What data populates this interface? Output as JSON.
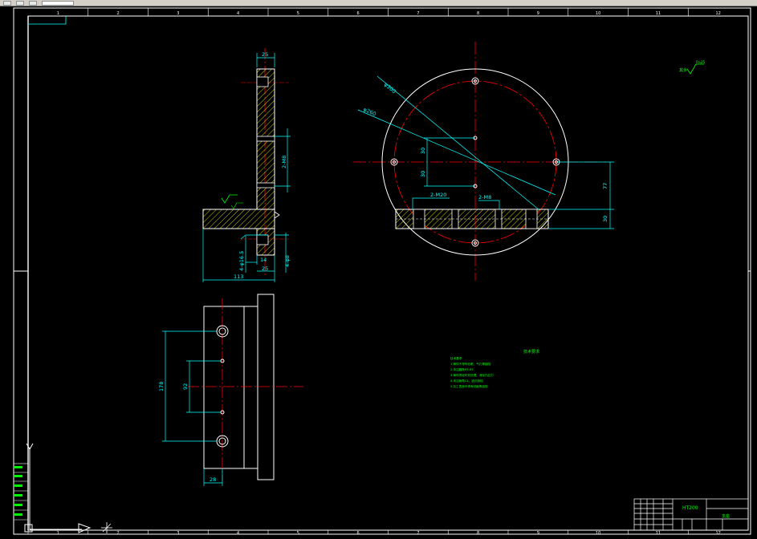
{
  "colors": {
    "background": "#000000",
    "frame": "#ffffff",
    "dimension": "#00ffff",
    "centerline": "#ff0000",
    "annotation": "#00ff00",
    "hatch": "#ffff00"
  },
  "frame": {
    "top_zones": [
      "1",
      "2",
      "3",
      "4",
      "5",
      "6",
      "7",
      "8",
      "9",
      "10",
      "11",
      "12"
    ],
    "bottom_zones": [
      "1",
      "2",
      "3",
      "4",
      "5",
      "6",
      "7",
      "8",
      "9",
      "10",
      "11",
      "12"
    ]
  },
  "section_view": {
    "dims": {
      "top_width": "25",
      "thread_upper": "2-M8",
      "flange_length": "113",
      "hole_dia": "4-φ16.5",
      "inner_14": "14",
      "inner_25": "25",
      "thread_lower": "4-φ8"
    }
  },
  "plan_view": {
    "dims": {
      "diameter_outer": "φ300",
      "diameter_pcd": "φ260",
      "gap_upper": "30",
      "gap_lower": "30",
      "thread_a": "2-M20",
      "thread_b": "2-M8",
      "height_77": "77",
      "height_30": "30"
    }
  },
  "bottom_view": {
    "dims": {
      "span_178": "178",
      "span_92": "92",
      "width_28": "28"
    }
  },
  "roughness_symbol": {
    "prefix": "其余",
    "value": "Ra25"
  },
  "notes": {
    "title": "技术要求",
    "heading": "技术要求",
    "lines": [
      "1.铸件不得有砂眼、气孔等缺陷",
      "2.未注圆角R3-R5",
      "3.铸件须经时效处理，消除内应力",
      "4.未注倒角C1，锐边倒钝",
      "5.加工表面不得有划痕等缺陷"
    ]
  },
  "title_block": {
    "material": "HT200",
    "part_name": "支座"
  }
}
